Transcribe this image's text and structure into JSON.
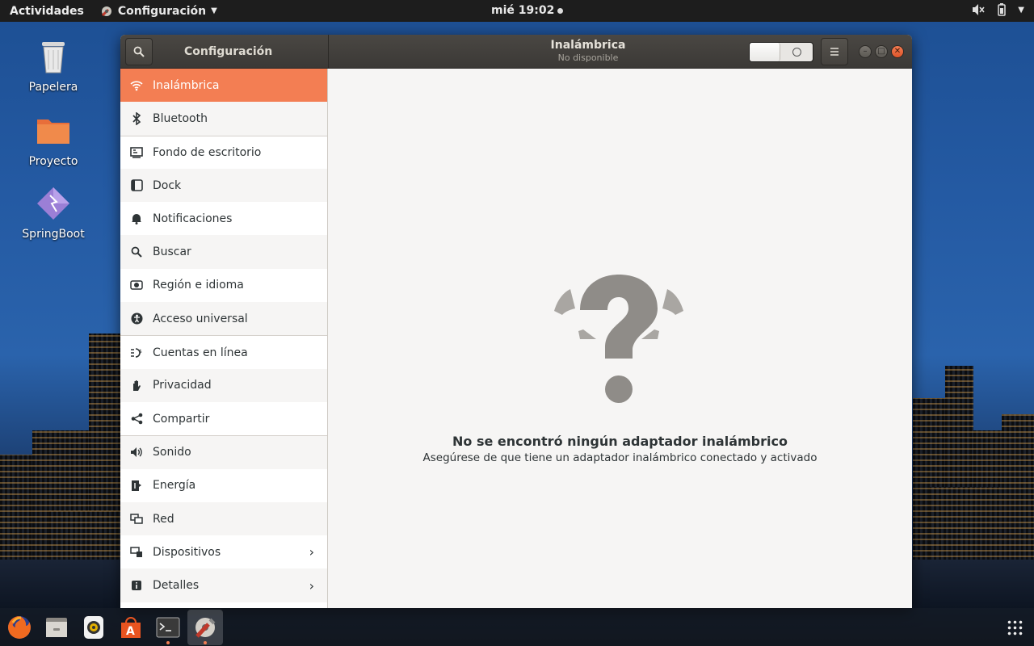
{
  "topbar": {
    "activities": "Actividades",
    "app_menu": "Configuración",
    "clock": "mié 19:02"
  },
  "desktop": {
    "icons": [
      {
        "label": "Papelera",
        "icon": "trash-icon"
      },
      {
        "label": "Proyecto",
        "icon": "folder-icon"
      },
      {
        "label": "SpringBoot",
        "icon": "springboot-launcher-icon"
      }
    ]
  },
  "window": {
    "sidebar_title": "Configuración",
    "panel_title": "Inalámbrica",
    "panel_subtitle": "No disponible",
    "wireless_switch": "off"
  },
  "sidebar": {
    "items": [
      {
        "label": "Inalámbrica",
        "icon": "wifi-icon",
        "active": true
      },
      {
        "label": "Bluetooth",
        "icon": "bluetooth-icon"
      },
      {
        "label": "Fondo de escritorio",
        "icon": "background-icon"
      },
      {
        "label": "Dock",
        "icon": "dock-icon"
      },
      {
        "label": "Notificaciones",
        "icon": "bell-icon"
      },
      {
        "label": "Buscar",
        "icon": "search-icon"
      },
      {
        "label": "Región e idioma",
        "icon": "region-icon"
      },
      {
        "label": "Acceso universal",
        "icon": "accessibility-icon"
      },
      {
        "label": "Cuentas en línea",
        "icon": "online-accounts-icon"
      },
      {
        "label": "Privacidad",
        "icon": "hand-icon"
      },
      {
        "label": "Compartir",
        "icon": "share-icon"
      },
      {
        "label": "Sonido",
        "icon": "speaker-icon"
      },
      {
        "label": "Energía",
        "icon": "power-icon"
      },
      {
        "label": "Red",
        "icon": "network-icon"
      },
      {
        "label": "Dispositivos",
        "icon": "devices-icon",
        "chevron": true
      },
      {
        "label": "Detalles",
        "icon": "info-icon",
        "chevron": true
      }
    ]
  },
  "content": {
    "title": "No se encontró ningún adaptador inalámbrico",
    "subtitle": "Asegúrese de que tiene un adaptador inalámbrico conectado y activado"
  },
  "dock": {
    "items": [
      "firefox-icon",
      "file-manager-icon",
      "sound-juicer-icon",
      "software-center-icon",
      "terminal-icon",
      "settings-icon"
    ]
  },
  "colors": {
    "accent": "#f37e53",
    "titlebar": "#3f3d3a",
    "topbar": "#1d1d1d"
  }
}
